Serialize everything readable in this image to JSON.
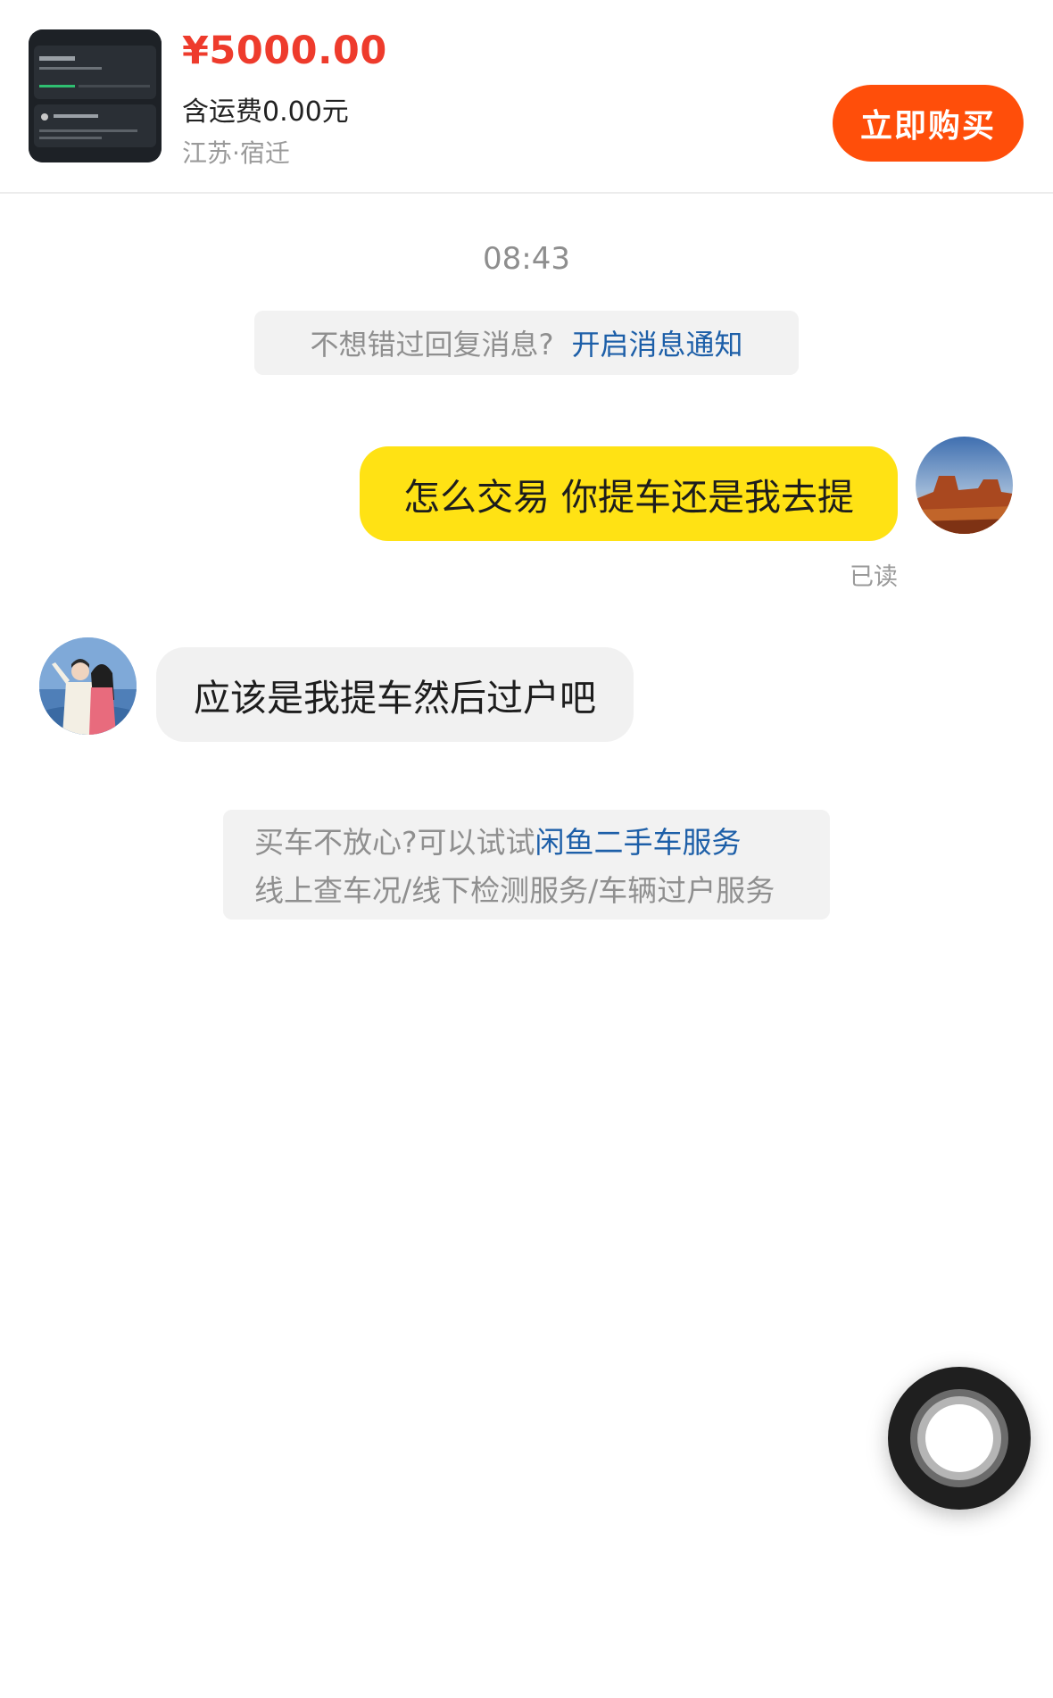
{
  "product": {
    "price": "¥5000.00",
    "shipping": "含运费0.00元",
    "location": "江苏·宿迁",
    "buy_button_label": "立即购买",
    "price_color": "#ee3b2c",
    "buy_button_color": "#ff4e0a"
  },
  "chat": {
    "timestamp": "08:43",
    "notify_tip": {
      "text": "不想错过回复消息?",
      "link": "开启消息通知"
    },
    "messages": [
      {
        "side": "right",
        "text": "怎么交易  你提车还是我去提",
        "status": "已读",
        "bubble_color": "#ffe214"
      },
      {
        "side": "left",
        "text": "应该是我提车然后过户吧",
        "bubble_color": "#f1f1f1"
      }
    ],
    "service_tip": {
      "line1_prefix": "买车不放心?可以试试",
      "line1_link": "闲鱼二手车服务",
      "line2": "线上查车况/线下检测服务/车辆过户服务"
    }
  },
  "icons": {
    "floating_button": "assistive-touch-icon"
  }
}
